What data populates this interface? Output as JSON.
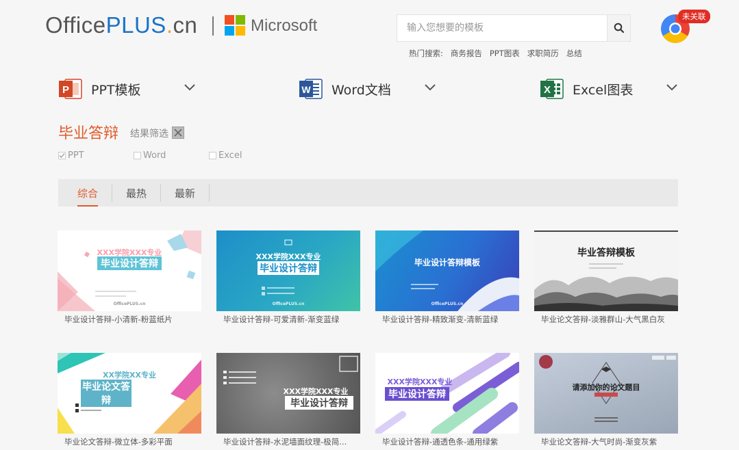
{
  "header": {
    "logo": {
      "office": "Office",
      "plus": "PLUS",
      "dot": ".",
      "cn": "cn"
    },
    "microsoft": "Microsoft",
    "search_placeholder": "输入您想要的模板",
    "hot_label": "热门搜索:",
    "hot_links": [
      "商务报告",
      "PPT图表",
      "求职简历",
      "总结"
    ],
    "badge": "未关联"
  },
  "categories": [
    {
      "label": "PPT模板",
      "icon": "powerpoint-icon",
      "color": "#d24726"
    },
    {
      "label": "Word文档",
      "icon": "word-icon",
      "color": "#2b579a"
    },
    {
      "label": "Excel图表",
      "icon": "excel-icon",
      "color": "#217346"
    }
  ],
  "page_title": "毕业答辩",
  "filter_label": "结果筛选",
  "filters": [
    {
      "label": "PPT",
      "checked": true
    },
    {
      "label": "Word",
      "checked": false
    },
    {
      "label": "Excel",
      "checked": false
    }
  ],
  "tabs": [
    {
      "label": "综合",
      "active": true
    },
    {
      "label": "最热",
      "active": false
    },
    {
      "label": "最新",
      "active": false
    }
  ],
  "templates": [
    {
      "caption": "毕业设计答辩-小清新-粉蓝纸片",
      "line1": "XXX学院XXX专业",
      "line2": "毕业设计答辩",
      "brand": "OfficePLUS.cn"
    },
    {
      "caption": "毕业设计答辩-可爱清新-渐变蓝绿",
      "line1": "XXX学院XXX专业",
      "line2": "毕业设计答辩",
      "brand": "OfficePLUS.cn"
    },
    {
      "caption": "毕业设计答辩-精致渐变-清新蓝绿",
      "line1": "毕业设计答辩模板",
      "brand": "OfficePLUS.cn"
    },
    {
      "caption": "毕业论文答辩-淡雅群山-大气黑白灰",
      "line1": "毕业答辩模板"
    },
    {
      "caption": "毕业论文答辩-微立体-多彩平面",
      "line1": "XX学院XX专业",
      "line2": "毕业论文答辩"
    },
    {
      "caption": "毕业设计答辩-水泥墙面纹理-极简...",
      "line1": "XXX学院XXX专业",
      "line2": "毕业设计答辩"
    },
    {
      "caption": "毕业设计答辩-通透色条-通用绿紫",
      "line1": "XXX学院XXX专业",
      "line2": "毕业设计答辩"
    },
    {
      "caption": "毕业论文答辩-大气时尚-渐变灰紫",
      "line1": "请添加你的论文题目"
    }
  ],
  "colors": {
    "accent": "#e05a2a",
    "badge": "#e02e24"
  }
}
